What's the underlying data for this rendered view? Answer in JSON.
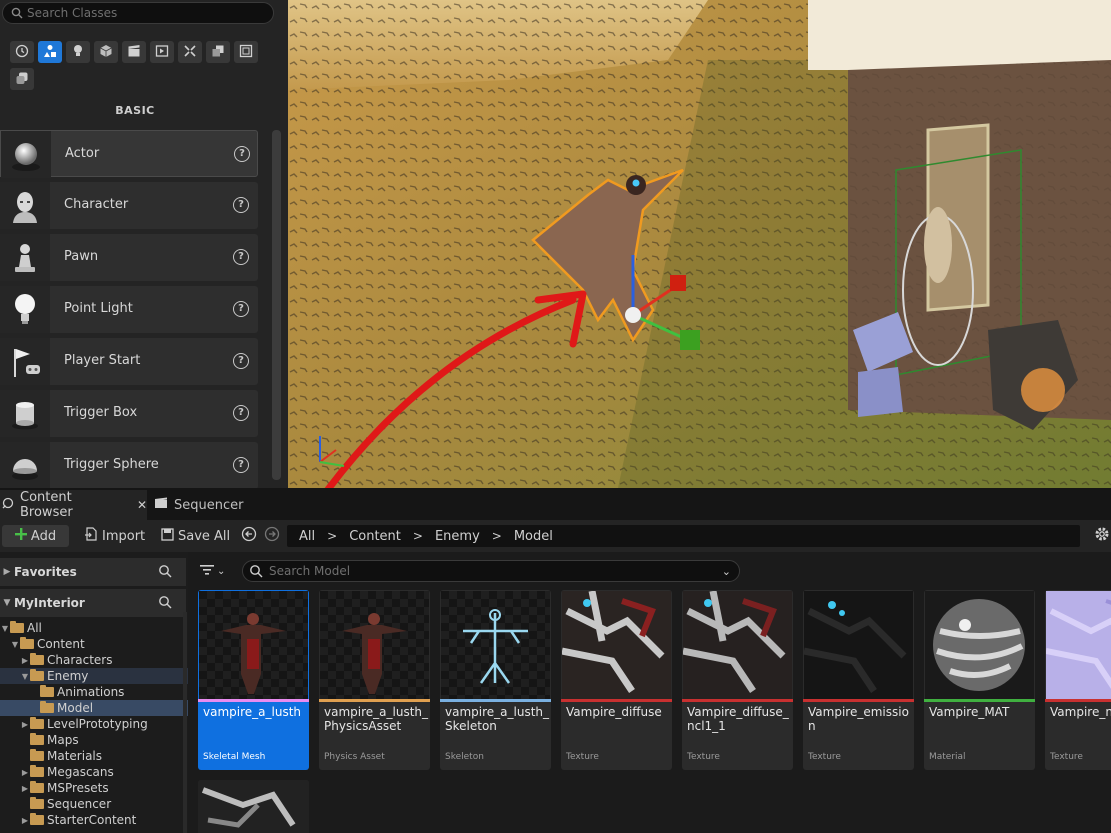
{
  "place_actors": {
    "search_placeholder": "Search Classes",
    "category_label": "BASIC",
    "categories": [
      "clock-icon",
      "actor-shapes-icon",
      "lightbulb-icon",
      "cube-icon",
      "cinematic-icon",
      "visual-effects-icon",
      "geometry-icon",
      "volumes-icon",
      "all-classes-icon",
      "shapes-stack-icon"
    ],
    "items": [
      {
        "label": "Actor",
        "icon": "sphere-actor-icon"
      },
      {
        "label": "Character",
        "icon": "character-head-icon"
      },
      {
        "label": "Pawn",
        "icon": "pawn-icon"
      },
      {
        "label": "Point Light",
        "icon": "lightbulb-icon"
      },
      {
        "label": "Player Start",
        "icon": "player-start-flag-icon"
      },
      {
        "label": "Trigger Box",
        "icon": "trigger-box-icon"
      },
      {
        "label": "Trigger Sphere",
        "icon": "trigger-sphere-icon"
      }
    ]
  },
  "tabs": [
    {
      "label": "Content Browser",
      "icon": "content-browser-icon"
    },
    {
      "label": "Sequencer",
      "icon": "sequencer-icon"
    }
  ],
  "toolbar": {
    "add_label": "Add",
    "import_label": "Import",
    "save_all_label": "Save All",
    "breadcrumb": [
      "All",
      "Content",
      "Enemy",
      "Model"
    ]
  },
  "sources": {
    "favorites_label": "Favorites",
    "project_label": "MyInterior",
    "tree": [
      {
        "label": "All",
        "depth": 0,
        "twist": "open"
      },
      {
        "label": "Content",
        "depth": 1,
        "twist": "open"
      },
      {
        "label": "Characters",
        "depth": 2,
        "twist": "closed"
      },
      {
        "label": "Enemy",
        "depth": 2,
        "twist": "open"
      },
      {
        "label": "Animations",
        "depth": 3,
        "twist": "none"
      },
      {
        "label": "Model",
        "depth": 3,
        "twist": "none"
      },
      {
        "label": "LevelPrototyping",
        "depth": 2,
        "twist": "closed"
      },
      {
        "label": "Maps",
        "depth": 2,
        "twist": "none"
      },
      {
        "label": "Materials",
        "depth": 2,
        "twist": "none"
      },
      {
        "label": "Megascans",
        "depth": 2,
        "twist": "closed"
      },
      {
        "label": "MSPresets",
        "depth": 2,
        "twist": "closed"
      },
      {
        "label": "Sequencer",
        "depth": 2,
        "twist": "none"
      },
      {
        "label": "StarterContent",
        "depth": 2,
        "twist": "closed"
      }
    ]
  },
  "assets": {
    "search_placeholder": "Search Model",
    "items": [
      {
        "name": "vampire_a_lusth",
        "type": "Skeletal Mesh",
        "color": "#e88cf0"
      },
      {
        "name": "vampire_a_lusth_PhysicsAsset",
        "type": "Physics Asset",
        "color": "#e0a050"
      },
      {
        "name": "vampire_a_lusth_Skeleton",
        "type": "Skeleton",
        "color": "#7ab0e0"
      },
      {
        "name": "Vampire_diffuse",
        "type": "Texture",
        "color": "#c83030"
      },
      {
        "name": "Vampire_diffuse_ncl1_1",
        "type": "Texture",
        "color": "#c83030"
      },
      {
        "name": "Vampire_emission",
        "type": "Texture",
        "color": "#c83030"
      },
      {
        "name": "Vampire_MAT",
        "type": "Material",
        "color": "#40b040"
      },
      {
        "name": "Vampire_n",
        "type": "Texture",
        "color": "#c83030"
      }
    ]
  }
}
